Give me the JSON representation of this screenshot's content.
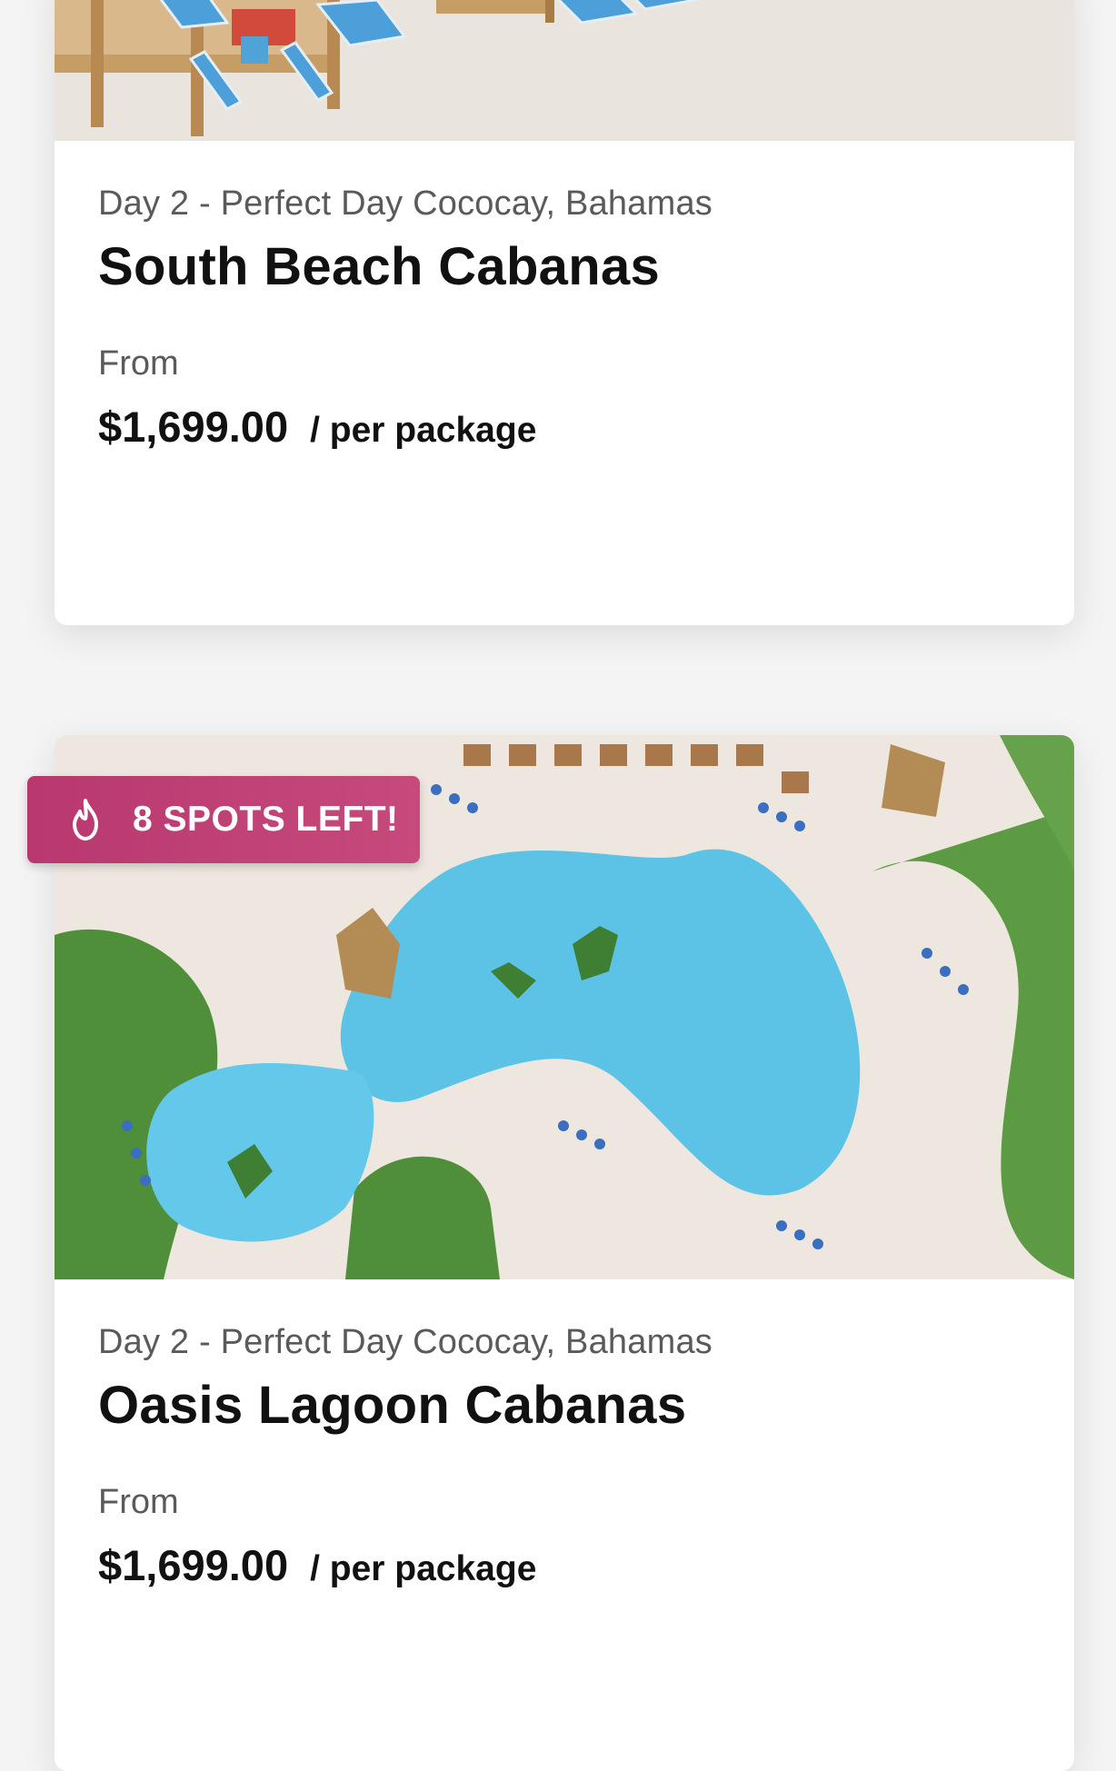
{
  "cards": [
    {
      "location": "Day 2 - Perfect Day Cococay, Bahamas",
      "title": "South Beach Cabanas",
      "from_label": "From",
      "price": "$1,699.00",
      "unit": "/ per package"
    },
    {
      "location": "Day 2 - Perfect Day Cococay, Bahamas",
      "title": "Oasis Lagoon Cabanas",
      "from_label": "From",
      "price": "$1,699.00",
      "unit": "/ per package",
      "badge": {
        "text": "8 SPOTS LEFT!",
        "icon": "flame-icon"
      }
    }
  ],
  "colors": {
    "badge": "#c0407a",
    "sand": "#ede7df",
    "pool": "#5cc3e6"
  }
}
